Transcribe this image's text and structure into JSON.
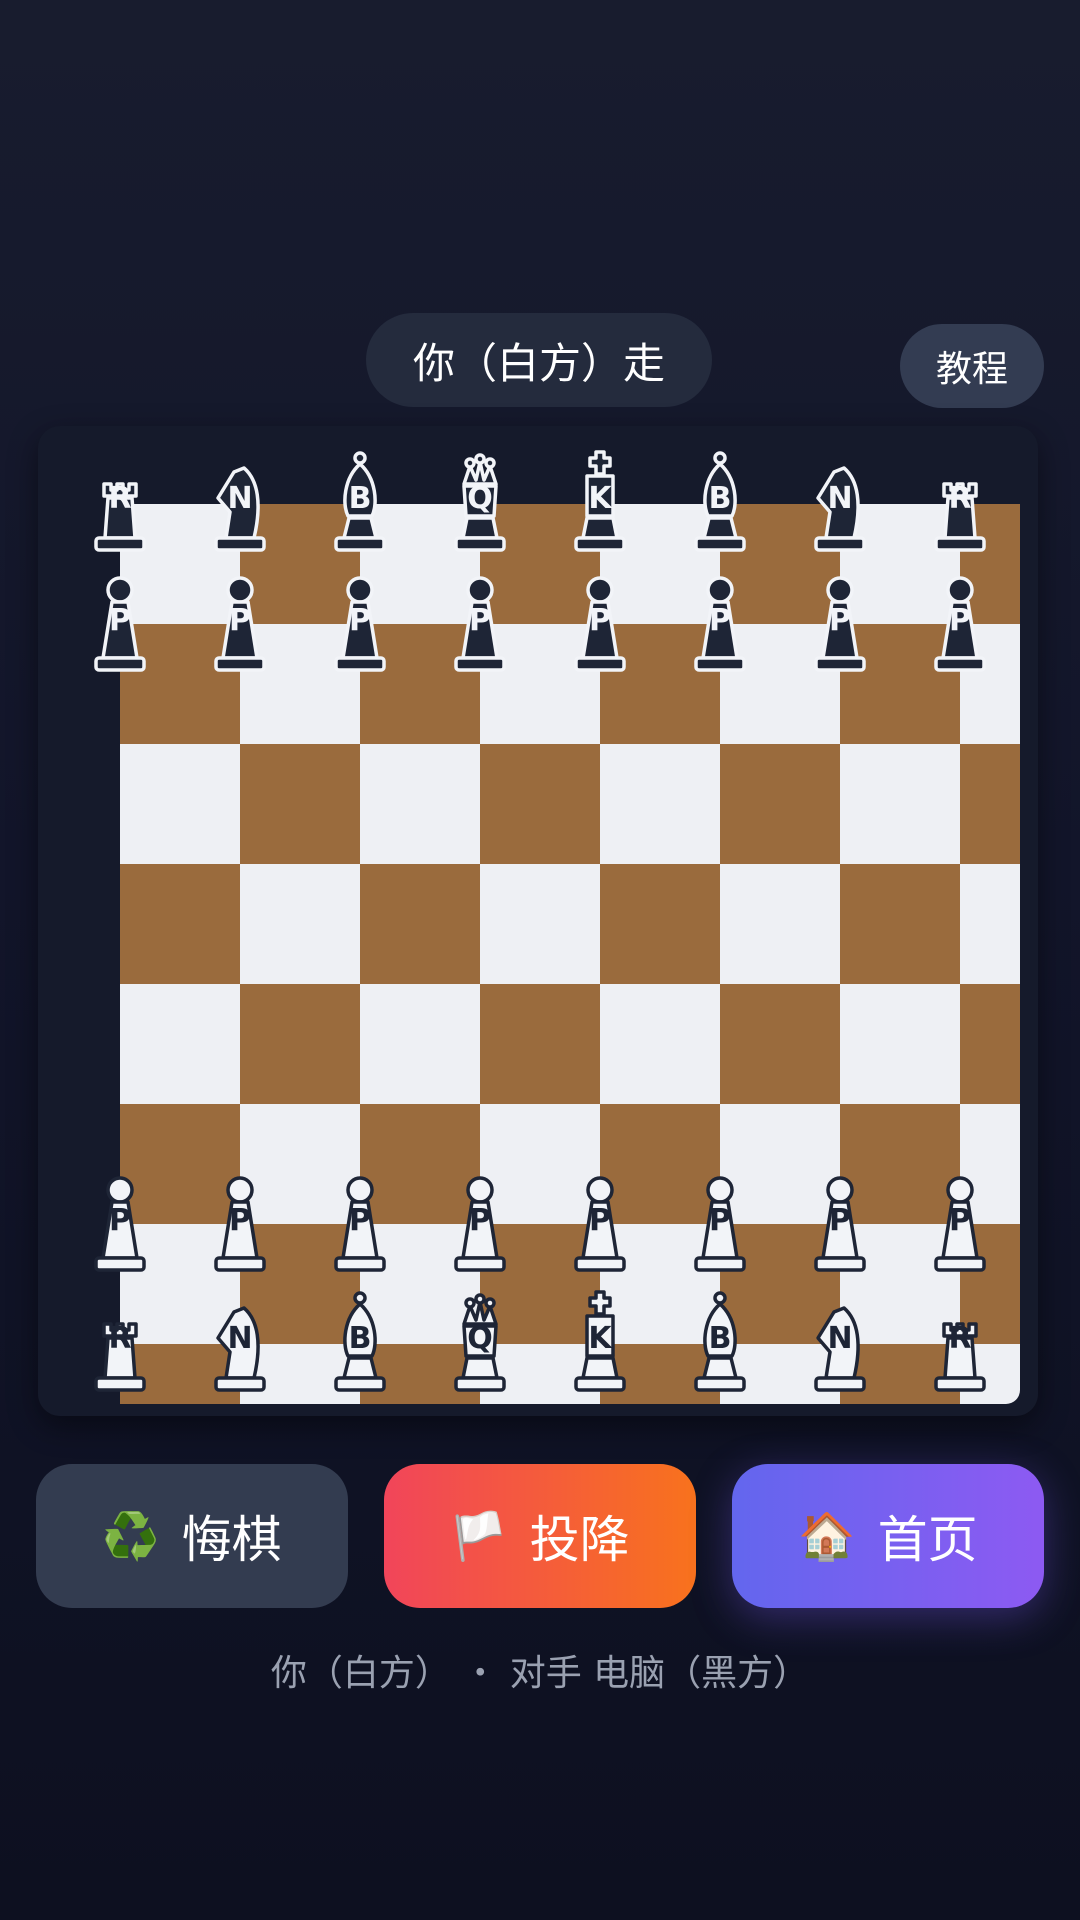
{
  "status": {
    "turn_text": "你（白方）走"
  },
  "header": {
    "tutorial_label": "教程"
  },
  "board": {
    "colors": {
      "light": "#eef0f4",
      "dark": "#9a6b3d"
    },
    "ranks": [
      [
        "bR",
        "bN",
        "bB",
        "bQ",
        "bK",
        "bB",
        "bN",
        "bR"
      ],
      [
        "bP",
        "bP",
        "bP",
        "bP",
        "bP",
        "bP",
        "bP",
        "bP"
      ],
      [
        "",
        "",
        "",
        "",
        "",
        "",
        "",
        ""
      ],
      [
        "",
        "",
        "",
        "",
        "",
        "",
        "",
        ""
      ],
      [
        "",
        "",
        "",
        "",
        "",
        "",
        "",
        ""
      ],
      [
        "",
        "",
        "",
        "",
        "",
        "",
        "",
        ""
      ],
      [
        "wP",
        "wP",
        "wP",
        "wP",
        "wP",
        "wP",
        "wP",
        "wP"
      ],
      [
        "wR",
        "wN",
        "wB",
        "wQ",
        "wK",
        "wB",
        "wN",
        "wR"
      ]
    ]
  },
  "actions": {
    "undo": {
      "icon": "♻️",
      "label": "悔棋"
    },
    "resign": {
      "icon": "🏳️",
      "label": "投降"
    },
    "home": {
      "icon": "🏠",
      "label": "首页"
    }
  },
  "footer": {
    "text": "你（白方）  ・ 对手 电脑（黑方）"
  }
}
